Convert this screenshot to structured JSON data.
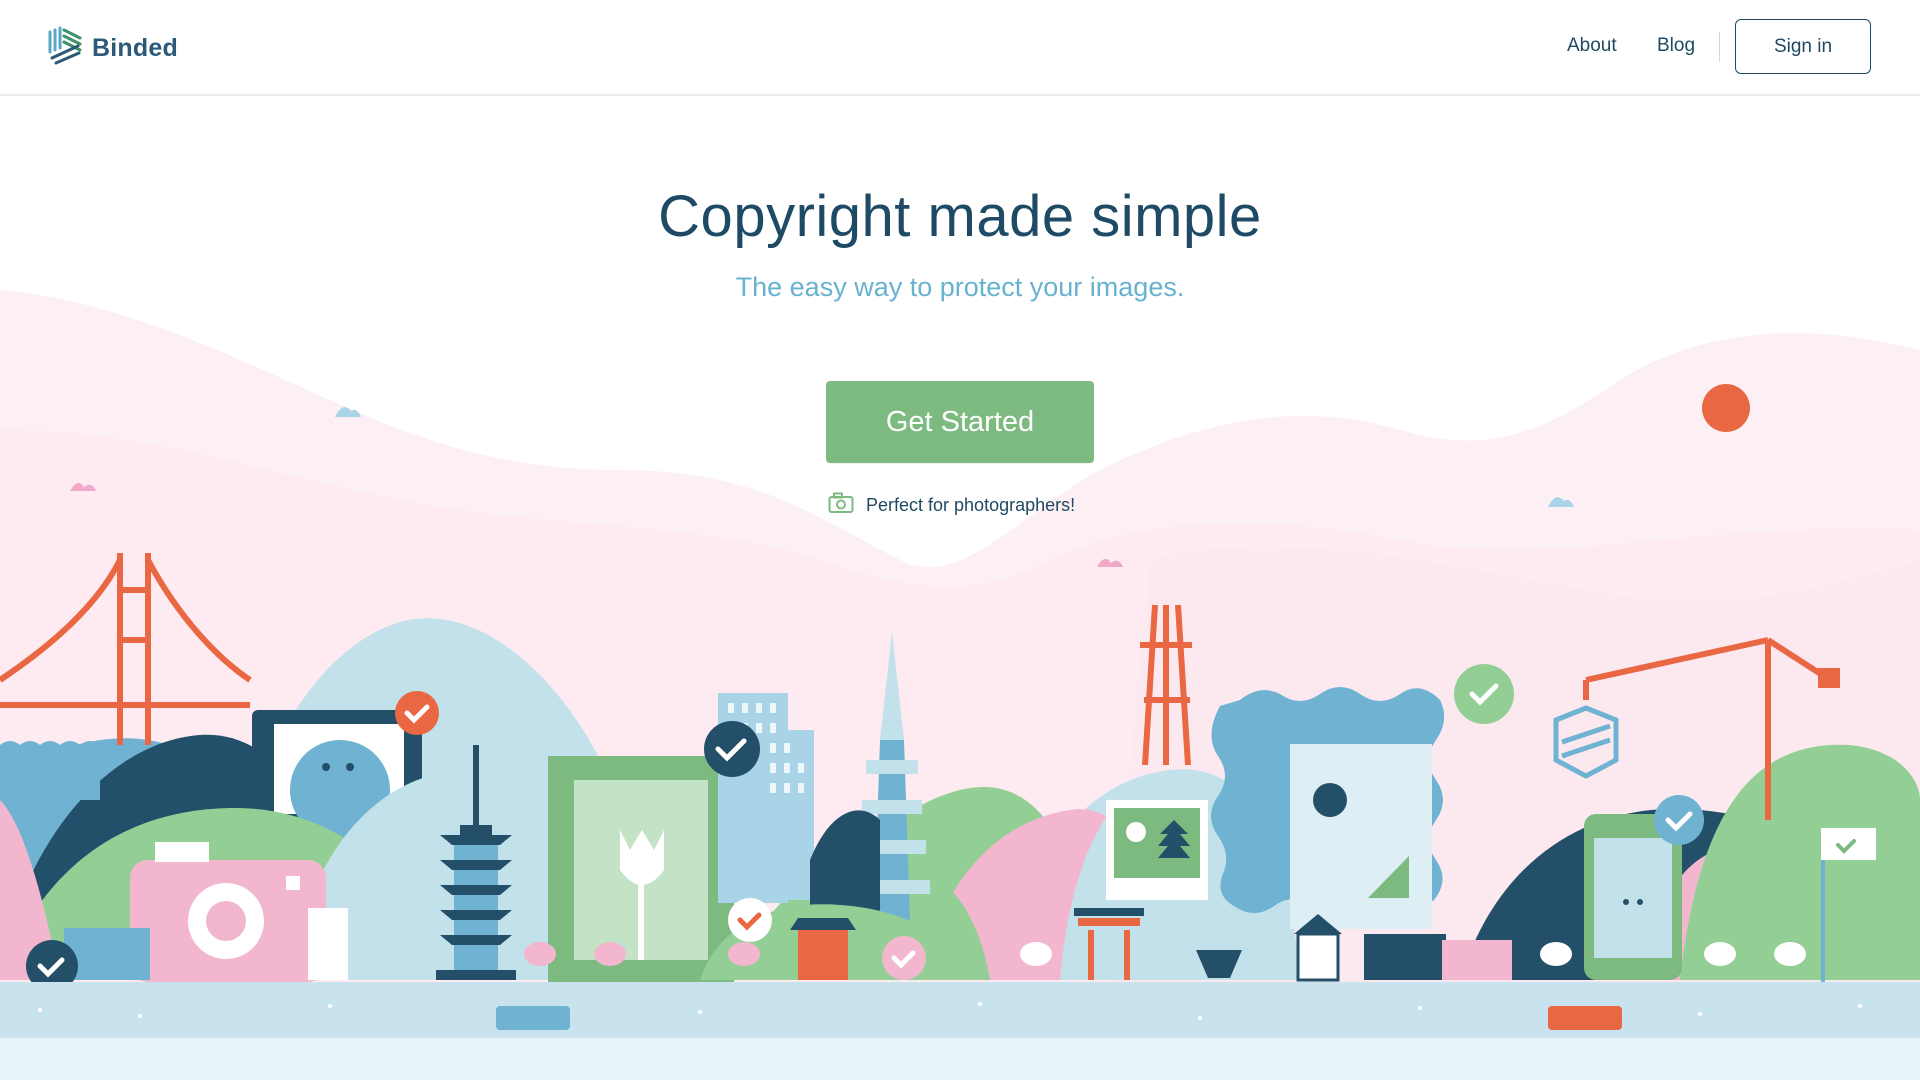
{
  "brand": {
    "name": "Binded",
    "logo_icon": "binded-logo-icon"
  },
  "nav": {
    "links": [
      {
        "label": "About"
      },
      {
        "label": "Blog"
      }
    ],
    "signin_label": "Sign in"
  },
  "hero": {
    "title": "Copyright made simple",
    "subtitle": "The easy way to protect your images.",
    "cta_label": "Get Started",
    "note_icon": "camera-icon",
    "note_text": "Perfect for photographers!"
  },
  "illustration": {
    "name": "city-skyline-illustration",
    "icons": [
      "golden-gate-bridge",
      "camera",
      "pagoda",
      "tulip-frame",
      "skyscraper",
      "sutro-tower",
      "photo-frame",
      "torii-gate",
      "crane",
      "phone",
      "check-badges"
    ]
  },
  "colors": {
    "navy": "#1e4a66",
    "accent_blue": "#67b2cf",
    "green": "#7cba80",
    "orange": "#e8684a",
    "pink": "#f3b6cf",
    "light_blue": "#c7e3ee"
  }
}
